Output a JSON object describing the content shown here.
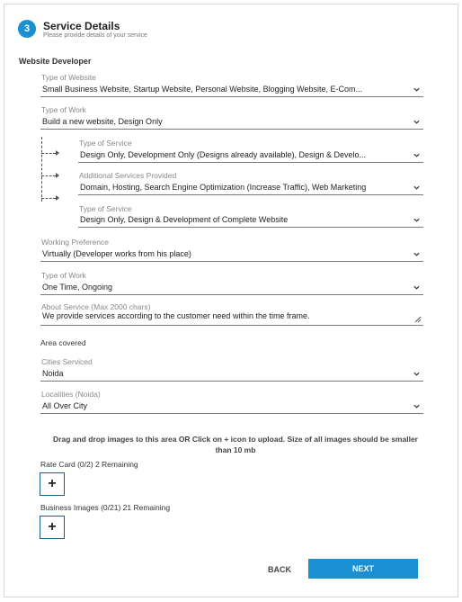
{
  "step": {
    "number": "3",
    "title": "Service Details",
    "subtitle": "Please provide details of your service"
  },
  "section_title": "Website Developer",
  "fields": {
    "type_of_website": {
      "label": "Type of Website",
      "value": "Small Business Website, Startup Website, Personal Website, Blogging Website, E-Com..."
    },
    "type_of_work": {
      "label": "Type of Work",
      "value": "Build a new website, Design Only"
    },
    "type_of_service_1": {
      "label": "Type of Service",
      "value": "Design Only, Development Only (Designs already available), Design & Develo..."
    },
    "additional_services": {
      "label": "Additional Services Provided",
      "value": "Domain, Hosting, Search Engine Optimization (Increase Traffic), Web Marketing"
    },
    "type_of_service_2": {
      "label": "Type of Service",
      "value": "Design Only, Design & Development of Complete Website"
    },
    "working_preference": {
      "label": "Working Preference",
      "value": "Virtually (Developer works from his place)"
    },
    "type_of_work_2": {
      "label": "Type of Work",
      "value": "One Time, Ongoing"
    },
    "about_service": {
      "label": "About Service (Max 2000 chars)",
      "value": "We provide services according to the customer need within the time frame."
    },
    "cities_serviced": {
      "label": "Cities Serviced",
      "value": "Noida"
    },
    "localities": {
      "label": "Localities (Noida)",
      "value": "All Over City"
    }
  },
  "area_covered_label": "Area covered",
  "upload_note": "Drag and drop images to this area OR Click on + icon to upload. Size of all images should be smaller than 10 mb",
  "rate_card_label": "Rate Card (0/2) 2 Remaining",
  "business_images_label": "Business Images (0/21) 21 Remaining",
  "plus_symbol": "+",
  "buttons": {
    "back": "BACK",
    "next": "NEXT"
  },
  "colors": {
    "accent": "#1a8fd1",
    "border": "#d7d7d7"
  }
}
